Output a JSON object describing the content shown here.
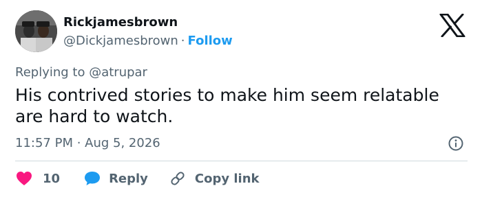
{
  "author": {
    "display_name": "Rickjamesbrown",
    "handle": "@Dickjamesbrown",
    "separator": "·",
    "follow_label": "Follow"
  },
  "reply_context": "Replying to @atrupar",
  "tweet": {
    "text": "His contrived stories to make him seem relatable are hard to watch.",
    "timestamp": "11:57 PM · Aug 5, 2026"
  },
  "actions": {
    "like_count": "10",
    "reply_label": "Reply",
    "copy_link_label": "Copy link"
  },
  "icons": {
    "logo": "x-logo-icon",
    "info": "info-icon",
    "like": "heart-icon",
    "reply": "speech-bubble-icon",
    "copy_link": "link-icon"
  },
  "colors": {
    "text": "#0f1419",
    "secondary": "#536471",
    "accent": "#1d9bf0",
    "like": "#f91880",
    "divider": "#cfd9de"
  }
}
